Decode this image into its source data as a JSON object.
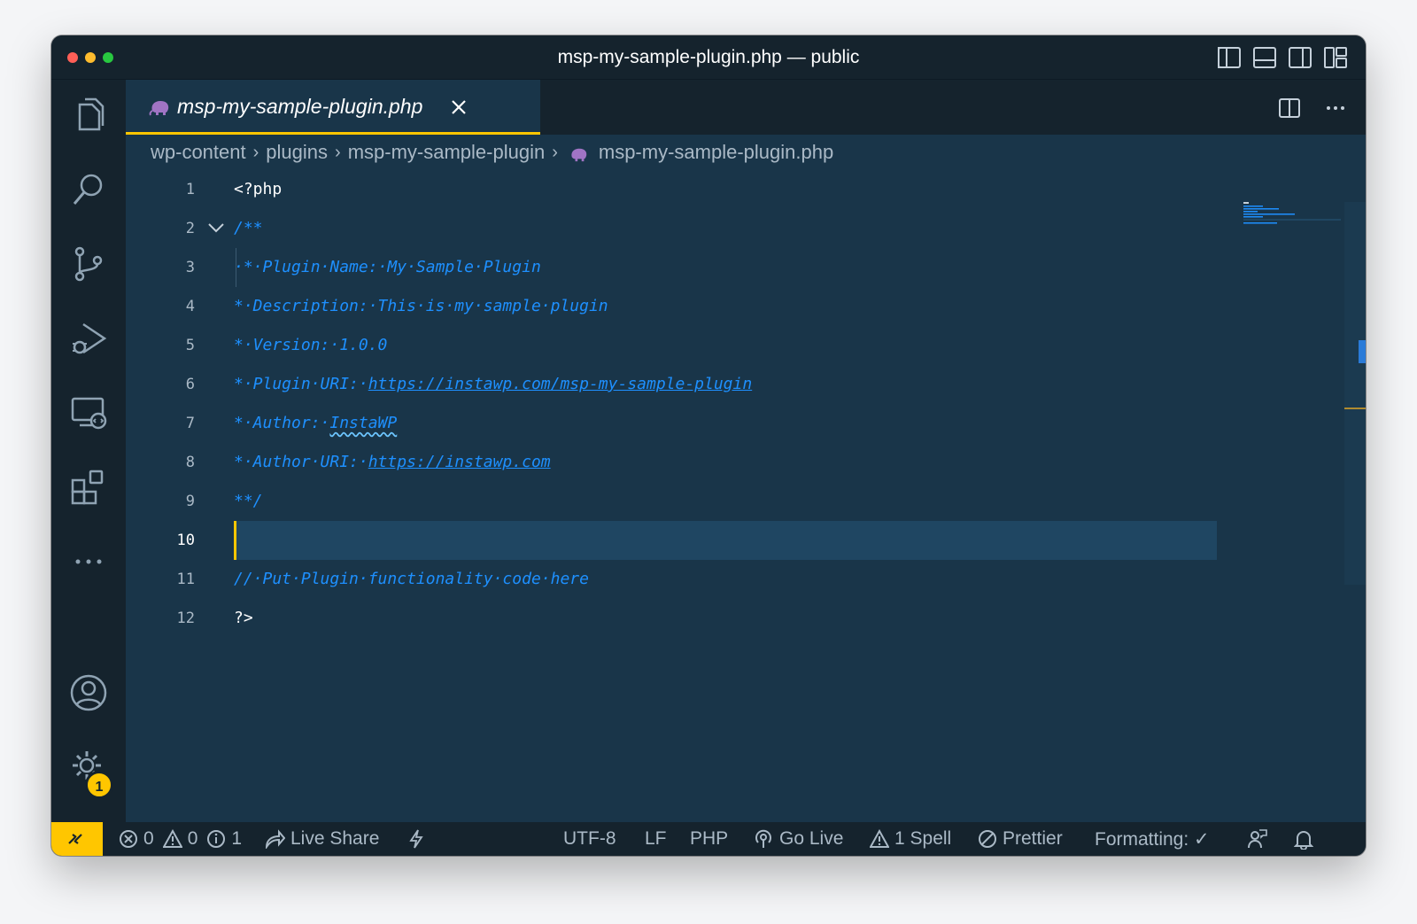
{
  "window": {
    "title": "msp-my-sample-plugin.php — public"
  },
  "tab": {
    "label": "msp-my-sample-plugin.php"
  },
  "breadcrumb": [
    "wp-content",
    "plugins",
    "msp-my-sample-plugin",
    "msp-my-sample-plugin.php"
  ],
  "activity": {
    "settings_badge": "1"
  },
  "editor": {
    "lines": [
      {
        "n": "1",
        "text": "<?php"
      },
      {
        "n": "2",
        "text": "/**"
      },
      {
        "n": "3",
        "text": "·*·Plugin·Name:·My·Sample·Plugin"
      },
      {
        "n": "4",
        "text": "*·Description:·This·is·my·sample·plugin"
      },
      {
        "n": "5",
        "text": "*·Version:·1.0.0"
      },
      {
        "n": "6",
        "prefix": "*·Plugin·URI:·",
        "link": "https://instawp.com/msp-my-sample-plugin"
      },
      {
        "n": "7",
        "prefix": "*·Author:·",
        "link": "InstaWP"
      },
      {
        "n": "8",
        "prefix": "*·Author·URI:·",
        "link": "https://instawp.com"
      },
      {
        "n": "9",
        "text": "**/"
      },
      {
        "n": "10",
        "text": ""
      },
      {
        "n": "11",
        "text": "//·Put·Plugin·functionality·code·here"
      },
      {
        "n": "12",
        "text": "?>"
      }
    ]
  },
  "status": {
    "errors": "0",
    "warnings": "0",
    "infos": "1",
    "live_share": "Live Share",
    "encoding": "UTF-8",
    "eol": "LF",
    "language": "PHP",
    "go_live": "Go Live",
    "spell": "1 Spell",
    "prettier": "Prettier",
    "formatting": "Formatting: ✓"
  },
  "colors": {
    "background": "#193549",
    "chrome": "#15232d",
    "accent": "#ffc600",
    "comment": "#1e90ff"
  }
}
